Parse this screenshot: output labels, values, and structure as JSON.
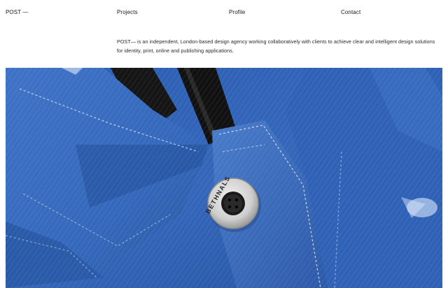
{
  "header": {
    "logo": "POST —",
    "nav": {
      "projects": "Projects",
      "profile": "Profile",
      "contact": "Contact"
    }
  },
  "intro": {
    "text": "POST— is an independent, London-based design agency working collaboratively with clients to achieve clear and intelligent design solutions for identity, print, online and publishing applications."
  },
  "hero": {
    "subject": "denim jacket collar with metal button",
    "button_text": "BETHNALS",
    "colors": {
      "denim": "#2f63b8",
      "denim_light": "#5f8fd6",
      "denim_dark": "#1a3f80",
      "tape": "#141414"
    }
  }
}
